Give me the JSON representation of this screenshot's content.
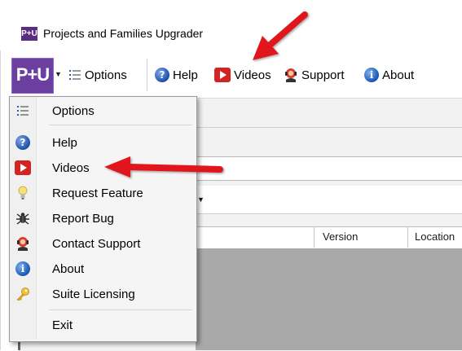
{
  "window": {
    "app_icon_text": "P+U",
    "title": "Projects and Families Upgrader"
  },
  "toolbar": {
    "logo_text": "P+U",
    "options_label": "Options",
    "help_label": "Help",
    "videos_label": "Videos",
    "support_label": "Support",
    "about_label": "About"
  },
  "grid": {
    "columns": [
      "Version",
      "Location"
    ]
  },
  "menu": {
    "items": [
      {
        "label": "Options",
        "icon": "list-icon"
      },
      {
        "label": "Help",
        "icon": "help-icon"
      },
      {
        "label": "Videos",
        "icon": "video-icon"
      },
      {
        "label": "Request Feature",
        "icon": "lightbulb-icon"
      },
      {
        "label": "Report Bug",
        "icon": "bug-icon"
      },
      {
        "label": "Contact Support",
        "icon": "support-icon"
      },
      {
        "label": "About",
        "icon": "info-icon"
      },
      {
        "label": "Suite Licensing",
        "icon": "key-icon"
      },
      {
        "label": "Exit",
        "icon": ""
      }
    ]
  },
  "colors": {
    "logo_purple": "#6b3fa0",
    "video_red": "#d42323",
    "arrow_red": "#e0191b",
    "info_blue": "#1656b5"
  }
}
